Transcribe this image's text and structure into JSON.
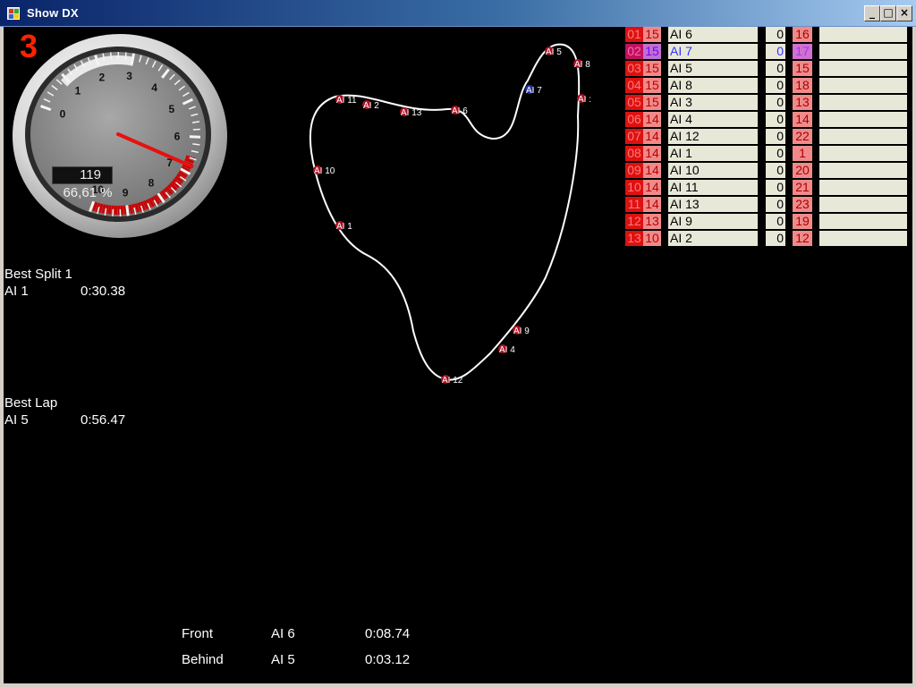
{
  "window": {
    "title": "Show DX"
  },
  "gauge": {
    "gear": "3",
    "readout": "119",
    "percent": "66,61 %",
    "scale": [
      "0",
      "1",
      "2",
      "3",
      "4",
      "5",
      "6",
      "7",
      "8",
      "9",
      "10"
    ],
    "needle_value": 6.8
  },
  "best_split": {
    "label": "Best Split 1",
    "driver": "AI 1",
    "time": "0:30.38"
  },
  "best_lap": {
    "label": "Best Lap",
    "driver": "AI 5",
    "time": "0:56.47"
  },
  "track": {
    "markers": [
      "AI 5",
      "AI 8",
      "AI 7",
      "AI :",
      "AI 11",
      "AI 2",
      "AI 13",
      "AI 6",
      "AI 10",
      "AI 1",
      "AI 9",
      "AI 4",
      "AI 12"
    ]
  },
  "standings": [
    {
      "pos": "01",
      "lap": "15",
      "name": "AI 6",
      "gap": "0",
      "num": "16",
      "highlight": false
    },
    {
      "pos": "02",
      "lap": "15",
      "name": "AI 7",
      "gap": "0",
      "num": "17",
      "highlight": true
    },
    {
      "pos": "03",
      "lap": "15",
      "name": "AI 5",
      "gap": "0",
      "num": "15",
      "highlight": false
    },
    {
      "pos": "04",
      "lap": "15",
      "name": "AI 8",
      "gap": "0",
      "num": "18",
      "highlight": false
    },
    {
      "pos": "05",
      "lap": "15",
      "name": "AI 3",
      "gap": "0",
      "num": "13",
      "highlight": false
    },
    {
      "pos": "06",
      "lap": "14",
      "name": "AI 4",
      "gap": "0",
      "num": "14",
      "highlight": false
    },
    {
      "pos": "07",
      "lap": "14",
      "name": "AI 12",
      "gap": "0",
      "num": "22",
      "highlight": false
    },
    {
      "pos": "08",
      "lap": "14",
      "name": "AI 1",
      "gap": "0",
      "num": "1",
      "highlight": false
    },
    {
      "pos": "09",
      "lap": "14",
      "name": "AI 10",
      "gap": "0",
      "num": "20",
      "highlight": false
    },
    {
      "pos": "10",
      "lap": "14",
      "name": "AI 11",
      "gap": "0",
      "num": "21",
      "highlight": false
    },
    {
      "pos": "11",
      "lap": "14",
      "name": "AI 13",
      "gap": "0",
      "num": "23",
      "highlight": false
    },
    {
      "pos": "12",
      "lap": "13",
      "name": "AI 9",
      "gap": "0",
      "num": "19",
      "highlight": false
    },
    {
      "pos": "13",
      "lap": "10",
      "name": "AI 2",
      "gap": "0",
      "num": "12",
      "highlight": false
    }
  ],
  "front": {
    "label": "Front",
    "driver": "AI 6",
    "gap": "0:08.74"
  },
  "behind": {
    "label": "Behind",
    "driver": "AI 5",
    "gap": "0:03.12"
  },
  "colors": {
    "accent_red": "#dd1111",
    "marker_fill": "#aa1122",
    "track": "#ffffff",
    "highlight": "#3333ff"
  }
}
